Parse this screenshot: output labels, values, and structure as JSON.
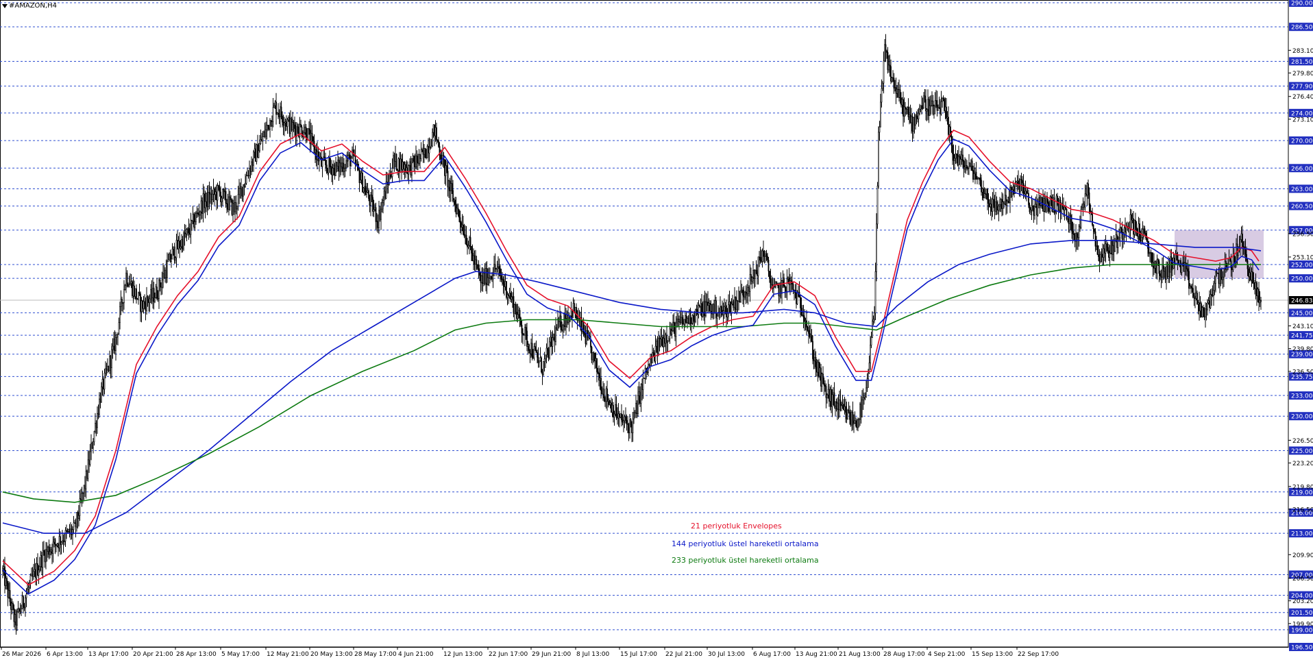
{
  "window": {
    "symbol_title": "#AMAZON,H4",
    "menu_icon": "triangle-down-icon"
  },
  "colors": {
    "background": "#ffffff",
    "grid": "#2f4fd0",
    "candle": "#000000",
    "envelope": "#e5112b",
    "ema144": "#0a18c8",
    "ema233": "#0c7a10",
    "label_bg": "#2230c0",
    "price_bg": "#000000",
    "zone_fill": "#b8a0cc"
  },
  "legend": {
    "envelopes": "21 periyotluk Envelopes",
    "ema144": "144 periyotluk üstel hareketli ortalama",
    "ema233": "233 periyotluk üstel hareketli ortalama"
  },
  "chart_data": {
    "type": "candlestick",
    "title": "#AMAZON,H4",
    "timeframe": "H4",
    "ylim": [
      196.5,
      290.0
    ],
    "grid": true,
    "grid_style": "dashed horizontal",
    "current_price": 246.83,
    "level_lines": [
      290.0,
      286.5,
      281.5,
      277.9,
      274.0,
      270.0,
      266.0,
      263.0,
      260.5,
      257.0,
      252.0,
      250.0,
      245.0,
      241.75,
      239.0,
      235.75,
      233.0,
      230.0,
      225.0,
      219.0,
      216.0,
      213.0,
      207.0,
      204.0,
      201.5,
      199.0,
      196.5
    ],
    "plain_ticks": [
      283.1,
      279.8,
      276.4,
      273.1,
      256.5,
      253.1,
      243.1,
      239.8,
      236.5,
      226.5,
      223.2,
      219.8,
      216.5,
      209.9,
      206.5,
      203.2,
      199.9
    ],
    "x_tick_labels": [
      "26 Mar 2026",
      "6 Apr 13:00",
      "13 Apr 17:00",
      "20 Apr 21:00",
      "28 Apr 13:00",
      "5 May 17:00",
      "12 May 21:00",
      "20 May 13:00",
      "28 May 17:00",
      "4 Jun 21:00",
      "12 Jun 13:00",
      "22 Jun 17:00",
      "29 Jun 21:00",
      "8 Jul 13:00",
      "15 Jul 17:00",
      "22 Jul 21:00",
      "30 Jul 13:00",
      "6 Aug 17:00",
      "13 Aug 21:00",
      "21 Aug 13:00",
      "28 Aug 17:00",
      "4 Sep 21:00",
      "15 Sep 13:00",
      "22 Sep 17:00"
    ],
    "price_path": [
      [
        0,
        207.5
      ],
      [
        12,
        200.0
      ],
      [
        25,
        205.0
      ],
      [
        40,
        210.0
      ],
      [
        55,
        212.0
      ],
      [
        70,
        213.5
      ],
      [
        80,
        220.0
      ],
      [
        95,
        233.0
      ],
      [
        110,
        241.0
      ],
      [
        120,
        250.5
      ],
      [
        135,
        246.0
      ],
      [
        150,
        248.0
      ],
      [
        165,
        253.5
      ],
      [
        180,
        256.5
      ],
      [
        195,
        261.0
      ],
      [
        210,
        262.5
      ],
      [
        225,
        260.0
      ],
      [
        240,
        266.0
      ],
      [
        255,
        271.0
      ],
      [
        265,
        275.0
      ],
      [
        280,
        272.0
      ],
      [
        295,
        271.5
      ],
      [
        310,
        266.5
      ],
      [
        325,
        266.0
      ],
      [
        340,
        267.5
      ],
      [
        355,
        262.0
      ],
      [
        365,
        258.5
      ],
      [
        380,
        267.0
      ],
      [
        395,
        266.0
      ],
      [
        410,
        268.0
      ],
      [
        420,
        271.5
      ],
      [
        435,
        263.0
      ],
      [
        450,
        256.5
      ],
      [
        465,
        249.5
      ],
      [
        480,
        251.5
      ],
      [
        495,
        247.0
      ],
      [
        510,
        241.0
      ],
      [
        525,
        237.0
      ],
      [
        540,
        243.0
      ],
      [
        555,
        245.5
      ],
      [
        570,
        240.5
      ],
      [
        585,
        233.5
      ],
      [
        600,
        229.5
      ],
      [
        612,
        228.5
      ],
      [
        625,
        236.0
      ],
      [
        640,
        241.0
      ],
      [
        655,
        243.0
      ],
      [
        670,
        244.5
      ],
      [
        685,
        246.0
      ],
      [
        700,
        245.0
      ],
      [
        715,
        247.0
      ],
      [
        730,
        250.0
      ],
      [
        740,
        254.0
      ],
      [
        750,
        248.0
      ],
      [
        765,
        249.5
      ],
      [
        780,
        245.0
      ],
      [
        790,
        238.0
      ],
      [
        800,
        233.5
      ],
      [
        815,
        231.0
      ],
      [
        830,
        229.0
      ],
      [
        840,
        233.0
      ],
      [
        848,
        246.0
      ],
      [
        852,
        270.0
      ],
      [
        858,
        283.0
      ],
      [
        865,
        279.0
      ],
      [
        875,
        275.0
      ],
      [
        885,
        272.5
      ],
      [
        895,
        275.5
      ],
      [
        905,
        274.5
      ],
      [
        915,
        275.0
      ],
      [
        925,
        268.0
      ],
      [
        935,
        266.5
      ],
      [
        945,
        265.5
      ],
      [
        955,
        262.5
      ],
      [
        965,
        260.0
      ],
      [
        980,
        262.0
      ],
      [
        990,
        264.0
      ],
      [
        1000,
        260.0
      ],
      [
        1015,
        261.0
      ],
      [
        1030,
        260.5
      ],
      [
        1045,
        256.0
      ],
      [
        1055,
        263.5
      ],
      [
        1065,
        253.5
      ],
      [
        1080,
        254.5
      ],
      [
        1095,
        258.5
      ],
      [
        1110,
        256.0
      ],
      [
        1120,
        252.0
      ],
      [
        1130,
        250.5
      ],
      [
        1140,
        253.0
      ],
      [
        1150,
        251.0
      ],
      [
        1160,
        247.0
      ],
      [
        1170,
        244.5
      ],
      [
        1180,
        250.0
      ],
      [
        1195,
        252.0
      ],
      [
        1205,
        255.5
      ],
      [
        1212,
        251.5
      ],
      [
        1218,
        248.5
      ],
      [
        1224,
        246.5
      ]
    ],
    "series": [
      {
        "name": "21 periyotluk Envelopes",
        "points": [
          [
            0,
            209.0
          ],
          [
            25,
            205.5
          ],
          [
            50,
            207.5
          ],
          [
            70,
            210.5
          ],
          [
            90,
            215.5
          ],
          [
            110,
            225.0
          ],
          [
            130,
            237.5
          ],
          [
            150,
            243.0
          ],
          [
            170,
            247.5
          ],
          [
            190,
            251.0
          ],
          [
            210,
            256.0
          ],
          [
            230,
            259.0
          ],
          [
            250,
            265.5
          ],
          [
            270,
            269.5
          ],
          [
            290,
            271.0
          ],
          [
            310,
            268.5
          ],
          [
            330,
            269.5
          ],
          [
            350,
            267.0
          ],
          [
            370,
            265.0
          ],
          [
            390,
            265.5
          ],
          [
            410,
            265.5
          ],
          [
            430,
            269.0
          ],
          [
            450,
            264.5
          ],
          [
            470,
            259.5
          ],
          [
            490,
            254.0
          ],
          [
            510,
            249.0
          ],
          [
            530,
            247.0
          ],
          [
            550,
            246.0
          ],
          [
            570,
            243.0
          ],
          [
            590,
            238.0
          ],
          [
            610,
            235.5
          ],
          [
            630,
            238.5
          ],
          [
            650,
            239.5
          ],
          [
            670,
            241.5
          ],
          [
            690,
            243.0
          ],
          [
            710,
            244.0
          ],
          [
            730,
            244.5
          ],
          [
            750,
            249.0
          ],
          [
            770,
            249.5
          ],
          [
            790,
            247.5
          ],
          [
            810,
            241.5
          ],
          [
            830,
            236.5
          ],
          [
            845,
            236.5
          ],
          [
            855,
            242.5
          ],
          [
            865,
            249.0
          ],
          [
            880,
            258.5
          ],
          [
            895,
            264.0
          ],
          [
            910,
            268.5
          ],
          [
            925,
            271.5
          ],
          [
            940,
            270.5
          ],
          [
            960,
            267.0
          ],
          [
            980,
            264.0
          ],
          [
            1000,
            263.0
          ],
          [
            1020,
            261.5
          ],
          [
            1040,
            260.0
          ],
          [
            1060,
            259.5
          ],
          [
            1080,
            258.5
          ],
          [
            1100,
            257.0
          ],
          [
            1120,
            255.5
          ],
          [
            1140,
            253.5
          ],
          [
            1160,
            253.0
          ],
          [
            1180,
            252.5
          ],
          [
            1195,
            253.0
          ],
          [
            1205,
            254.5
          ],
          [
            1215,
            254.0
          ],
          [
            1222,
            252.5
          ]
        ]
      },
      {
        "name": "144 periyotluk üstel hareketli ortalama",
        "points": [
          [
            0,
            214.5
          ],
          [
            40,
            213.0
          ],
          [
            80,
            213.0
          ],
          [
            120,
            216.0
          ],
          [
            160,
            220.5
          ],
          [
            200,
            225.0
          ],
          [
            240,
            230.0
          ],
          [
            280,
            235.0
          ],
          [
            320,
            239.5
          ],
          [
            360,
            243.0
          ],
          [
            400,
            246.5
          ],
          [
            440,
            250.0
          ],
          [
            460,
            251.0
          ],
          [
            490,
            250.5
          ],
          [
            520,
            249.5
          ],
          [
            560,
            248.0
          ],
          [
            600,
            246.5
          ],
          [
            640,
            245.5
          ],
          [
            680,
            245.0
          ],
          [
            720,
            245.0
          ],
          [
            760,
            245.5
          ],
          [
            790,
            245.0
          ],
          [
            820,
            243.5
          ],
          [
            850,
            243.0
          ],
          [
            870,
            246.0
          ],
          [
            900,
            249.5
          ],
          [
            930,
            252.0
          ],
          [
            960,
            253.5
          ],
          [
            1000,
            255.0
          ],
          [
            1040,
            255.5
          ],
          [
            1080,
            255.5
          ],
          [
            1120,
            255.0
          ],
          [
            1160,
            254.5
          ],
          [
            1200,
            254.5
          ],
          [
            1224,
            254.0
          ]
        ]
      },
      {
        "name": "233 periyotluk üstel hareketli ortalama",
        "points": [
          [
            0,
            219.0
          ],
          [
            30,
            218.0
          ],
          [
            70,
            217.5
          ],
          [
            110,
            218.5
          ],
          [
            150,
            221.0
          ],
          [
            200,
            224.5
          ],
          [
            250,
            228.5
          ],
          [
            300,
            233.0
          ],
          [
            350,
            236.5
          ],
          [
            400,
            239.5
          ],
          [
            440,
            242.5
          ],
          [
            470,
            243.5
          ],
          [
            510,
            244.0
          ],
          [
            560,
            244.0
          ],
          [
            600,
            243.5
          ],
          [
            640,
            243.0
          ],
          [
            680,
            243.0
          ],
          [
            720,
            243.0
          ],
          [
            760,
            243.5
          ],
          [
            790,
            243.5
          ],
          [
            820,
            243.0
          ],
          [
            850,
            242.5
          ],
          [
            880,
            244.5
          ],
          [
            920,
            247.0
          ],
          [
            960,
            249.0
          ],
          [
            1000,
            250.5
          ],
          [
            1040,
            251.5
          ],
          [
            1080,
            252.0
          ],
          [
            1120,
            252.0
          ],
          [
            1160,
            252.0
          ],
          [
            1200,
            252.0
          ],
          [
            1224,
            252.0
          ]
        ]
      }
    ],
    "zone": {
      "ymin": 250.0,
      "ymax": 257.0
    }
  }
}
